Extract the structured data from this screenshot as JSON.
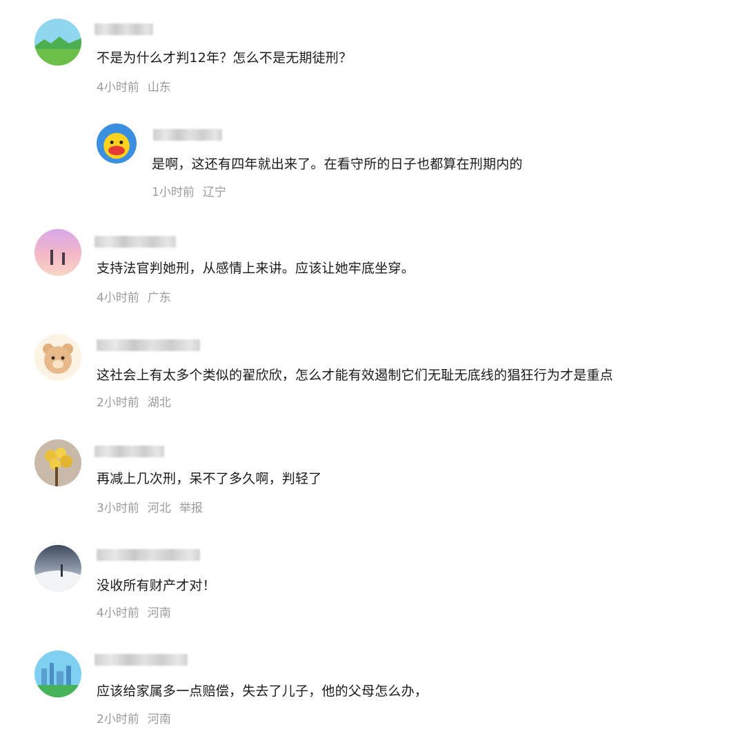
{
  "comments": [
    {
      "text": "不是为什么才判12年？怎么不是无期徒刑？",
      "time": "4小时前",
      "location": "山东",
      "avatar_icon": "landscape-avatar-icon"
    },
    {
      "text": "是啊，这还有四年就出来了。在看守所的日子也都算在刑期内的",
      "time": "1小时前",
      "location": "辽宁",
      "avatar_icon": "duck-avatar-icon",
      "reply": true
    },
    {
      "text": "支持法官判她刑，从感情上来讲。应该让她牢底坐穿。",
      "time": "4小时前",
      "location": "广东",
      "avatar_icon": "couple-sunset-avatar-icon"
    },
    {
      "text": "这社会上有太多个类似的翟欣欣，怎么才能有效遏制它们无耻无底线的猖狂行为才是重点",
      "time": "2小时前",
      "location": "湖北",
      "avatar_icon": "bear-avatar-icon"
    },
    {
      "text": "再减上几次刑，呆不了多久啊，判轻了",
      "time": "3小时前",
      "location": "河北",
      "report": "举报",
      "avatar_icon": "flowers-avatar-icon"
    },
    {
      "text": "没收所有财产才对！",
      "time": "4小时前",
      "location": "河南",
      "avatar_icon": "winter-avatar-icon"
    },
    {
      "text": "应该给家属多一点赔偿，失去了儿子，他的父母怎么办，",
      "time": "2小时前",
      "location": "河南",
      "avatar_icon": "city-skyline-avatar-icon"
    }
  ]
}
